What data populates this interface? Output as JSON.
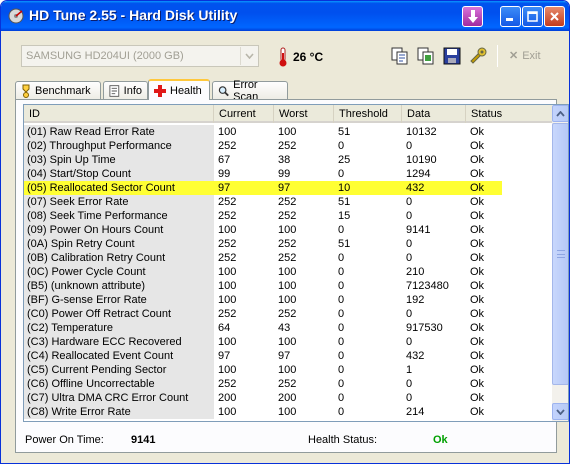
{
  "window": {
    "title": "HD Tune 2.55 - Hard Disk Utility"
  },
  "toolbar": {
    "drive": "SAMSUNG HD204UI (2000 GB)",
    "temperature": "26 °C",
    "exit_label": "Exit",
    "icons": [
      "copy-info-icon",
      "copy-screenshot-icon",
      "save-icon",
      "options-icon"
    ]
  },
  "tabs": [
    {
      "label": "Benchmark",
      "icon": "benchmark-icon"
    },
    {
      "label": "Info",
      "icon": "info-icon"
    },
    {
      "label": "Health",
      "icon": "health-cross-icon",
      "active": true
    },
    {
      "label": "Error Scan",
      "icon": "error-scan-icon"
    }
  ],
  "table": {
    "columns": [
      "ID",
      "Current",
      "Worst",
      "Threshold",
      "Data",
      "Status"
    ],
    "rows": [
      {
        "id": "(01) Raw Read Error Rate",
        "current": "100",
        "worst": "100",
        "threshold": "51",
        "data": "10132",
        "status": "Ok"
      },
      {
        "id": "(02) Throughput Performance",
        "current": "252",
        "worst": "252",
        "threshold": "0",
        "data": "0",
        "status": "Ok"
      },
      {
        "id": "(03) Spin Up Time",
        "current": "67",
        "worst": "38",
        "threshold": "25",
        "data": "10190",
        "status": "Ok"
      },
      {
        "id": "(04) Start/Stop Count",
        "current": "99",
        "worst": "99",
        "threshold": "0",
        "data": "1294",
        "status": "Ok"
      },
      {
        "id": "(05) Reallocated Sector Count",
        "current": "97",
        "worst": "97",
        "threshold": "10",
        "data": "432",
        "status": "Ok",
        "highlight": true
      },
      {
        "id": "(07) Seek Error Rate",
        "current": "252",
        "worst": "252",
        "threshold": "51",
        "data": "0",
        "status": "Ok"
      },
      {
        "id": "(08) Seek Time Performance",
        "current": "252",
        "worst": "252",
        "threshold": "15",
        "data": "0",
        "status": "Ok"
      },
      {
        "id": "(09) Power On Hours Count",
        "current": "100",
        "worst": "100",
        "threshold": "0",
        "data": "9141",
        "status": "Ok"
      },
      {
        "id": "(0A) Spin Retry Count",
        "current": "252",
        "worst": "252",
        "threshold": "51",
        "data": "0",
        "status": "Ok"
      },
      {
        "id": "(0B) Calibration Retry Count",
        "current": "252",
        "worst": "252",
        "threshold": "0",
        "data": "0",
        "status": "Ok"
      },
      {
        "id": "(0C) Power Cycle Count",
        "current": "100",
        "worst": "100",
        "threshold": "0",
        "data": "210",
        "status": "Ok"
      },
      {
        "id": "(B5) (unknown attribute)",
        "current": "100",
        "worst": "100",
        "threshold": "0",
        "data": "7123480",
        "status": "Ok"
      },
      {
        "id": "(BF) G-sense Error Rate",
        "current": "100",
        "worst": "100",
        "threshold": "0",
        "data": "192",
        "status": "Ok"
      },
      {
        "id": "(C0) Power Off Retract Count",
        "current": "252",
        "worst": "252",
        "threshold": "0",
        "data": "0",
        "status": "Ok"
      },
      {
        "id": "(C2) Temperature",
        "current": "64",
        "worst": "43",
        "threshold": "0",
        "data": "917530",
        "status": "Ok"
      },
      {
        "id": "(C3) Hardware ECC Recovered",
        "current": "100",
        "worst": "100",
        "threshold": "0",
        "data": "0",
        "status": "Ok"
      },
      {
        "id": "(C4) Reallocated Event Count",
        "current": "97",
        "worst": "97",
        "threshold": "0",
        "data": "432",
        "status": "Ok"
      },
      {
        "id": "(C5) Current Pending Sector",
        "current": "100",
        "worst": "100",
        "threshold": "0",
        "data": "1",
        "status": "Ok"
      },
      {
        "id": "(C6) Offline Uncorrectable",
        "current": "252",
        "worst": "252",
        "threshold": "0",
        "data": "0",
        "status": "Ok"
      },
      {
        "id": "(C7) Ultra DMA CRC Error Count",
        "current": "200",
        "worst": "200",
        "threshold": "0",
        "data": "0",
        "status": "Ok"
      },
      {
        "id": "(C8) Write Error Rate",
        "current": "100",
        "worst": "100",
        "threshold": "0",
        "data": "214",
        "status": "Ok"
      }
    ]
  },
  "footer": {
    "power_on_label": "Power On Time:",
    "power_on_value": "9141",
    "health_label": "Health Status:",
    "health_value": "Ok"
  },
  "colors": {
    "highlight": "#ffff33",
    "ok_green": "#00a000",
    "title_blue": "#0054e3"
  }
}
